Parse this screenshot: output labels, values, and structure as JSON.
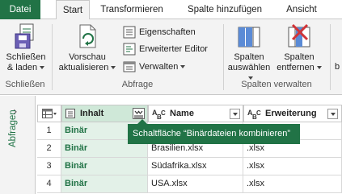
{
  "tabs": [
    {
      "label": "Datei"
    },
    {
      "label": "Start"
    },
    {
      "label": "Transformieren"
    },
    {
      "label": "Spalte hinzufügen"
    },
    {
      "label": "Ansicht"
    }
  ],
  "ribbon": {
    "close": {
      "line1": "Schließen",
      "line2": "& laden",
      "group": "Schließen"
    },
    "query": {
      "preview_line1": "Vorschau",
      "preview_line2": "aktualisieren",
      "properties": "Eigenschaften",
      "advanced_editor": "Erweiterter Editor",
      "manage": "Verwalten",
      "group": "Abfrage"
    },
    "columns": {
      "choose_line1": "Spalten",
      "choose_line2": "auswählen",
      "remove_line1": "Spalten",
      "remove_line2": "entfernen",
      "group": "Spalten verwalten"
    },
    "cut_text": "b"
  },
  "left_pane": {
    "label": "Abfragen",
    "expand_glyph": "›"
  },
  "table": {
    "columns": [
      {
        "label": "Inhalt"
      },
      {
        "label": "Name"
      },
      {
        "label": "Erweiterung"
      }
    ],
    "rows": [
      {
        "num": "1",
        "content": "Binär",
        "name": "",
        "ext": ""
      },
      {
        "num": "2",
        "content": "Binär",
        "name": "Brasilien.xlsx",
        "ext": ".xlsx"
      },
      {
        "num": "3",
        "content": "Binär",
        "name": "Südafrika.xlsx",
        "ext": ".xlsx"
      },
      {
        "num": "4",
        "content": "Binär",
        "name": "USA.xlsx",
        "ext": ".xlsx"
      }
    ]
  },
  "tooltip": {
    "text": "Schaltfläche “Binärdateien kombinieren”"
  },
  "colors": {
    "accent": "#217346",
    "selected_column": "#cfe8d8",
    "binary_cell": "#e3f1e8"
  }
}
